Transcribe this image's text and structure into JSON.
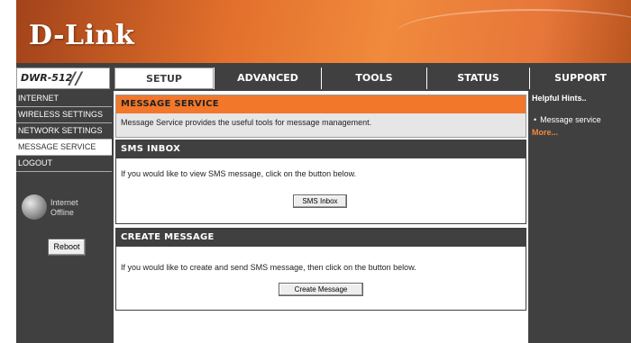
{
  "brand": {
    "logo": "D-Link"
  },
  "header": {
    "model": "DWR-512"
  },
  "tabs": [
    {
      "label": "SETUP"
    },
    {
      "label": "ADVANCED"
    },
    {
      "label": "TOOLS"
    },
    {
      "label": "STATUS"
    },
    {
      "label": "SUPPORT"
    }
  ],
  "sidebar": {
    "items": [
      {
        "label": "INTERNET"
      },
      {
        "label": "WIRELESS SETTINGS"
      },
      {
        "label": "NETWORK SETTINGS"
      },
      {
        "label": "MESSAGE SERVICE"
      },
      {
        "label": "LOGOUT"
      }
    ],
    "internet_status": "Internet",
    "internet_state": "Offline",
    "reboot_label": "Reboot"
  },
  "main": {
    "message_service": {
      "title": "MESSAGE SERVICE",
      "description": "Message Service provides the useful tools for message management."
    },
    "sms_inbox": {
      "title": "SMS INBOX",
      "description": "If you would like to view SMS message, click on the button below.",
      "button_label": "SMS Inbox"
    },
    "create_message": {
      "title": "CREATE MESSAGE",
      "description": "If you would like to create and send SMS message, then click on the button below.",
      "button_label": "Create Message"
    }
  },
  "hints": {
    "title": "Helpful Hints..",
    "item": "Message service",
    "more": "More..."
  },
  "colors": {
    "accent_orange": "#f2772b",
    "dark_gray": "#404040"
  }
}
